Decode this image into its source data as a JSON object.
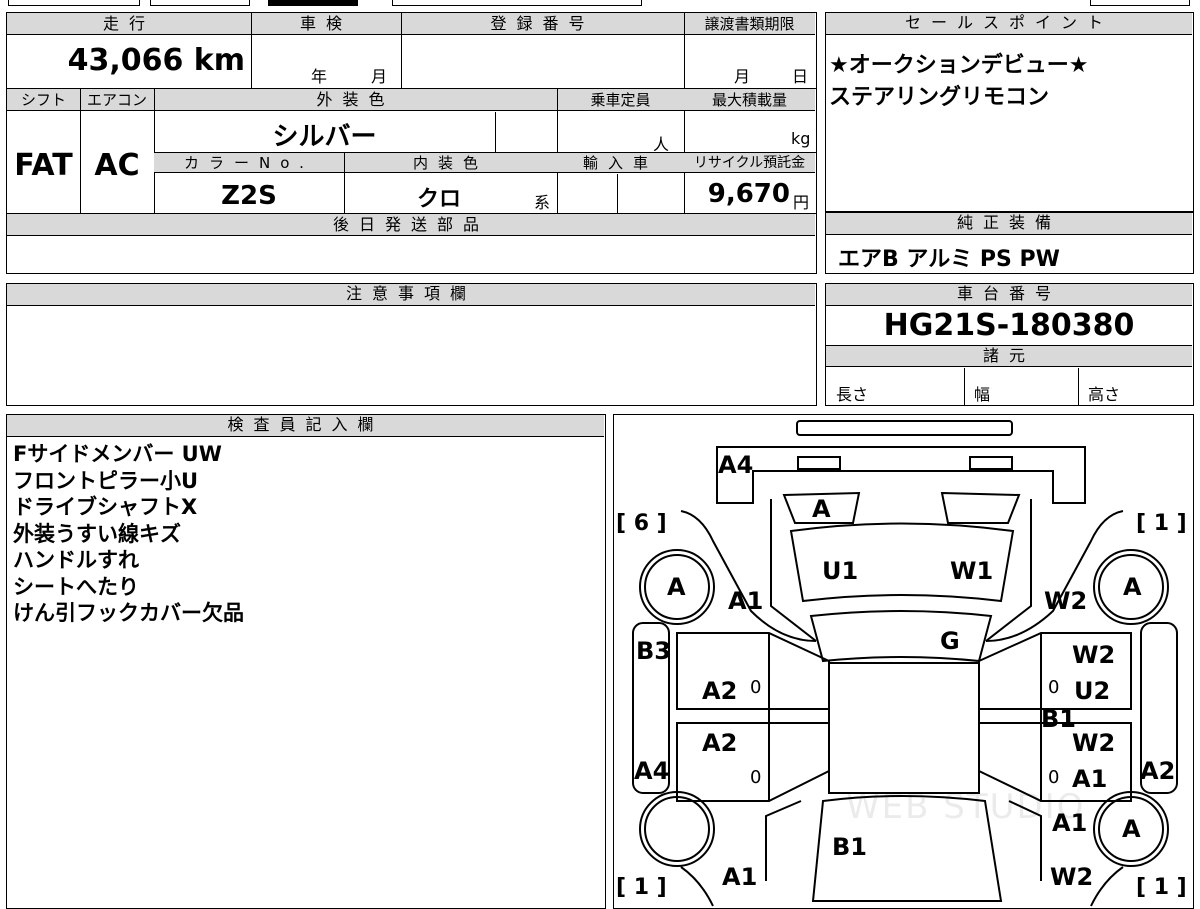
{
  "header": {
    "mileage_label": "走行",
    "inspection_label": "車検",
    "registration_label": "登録番号",
    "transfer_deadline_label": "譲渡書類期限",
    "mileage_value": "43,066 km",
    "year_unit": "年",
    "month_unit": "月",
    "deadline_month": "月",
    "deadline_day": "日",
    "shift_label": "シフト",
    "ac_label": "エアコン",
    "exterior_color_label": "外装色",
    "capacity_label": "乗車定員",
    "max_load_label": "最大積載量",
    "shift_value": "FAT",
    "ac_value": "AC",
    "exterior_color_value": "シルバー",
    "capacity_unit": "人",
    "load_unit": "kg",
    "color_no_label": "カラーNo.",
    "interior_color_label": "内装色",
    "import_label": "輸入車",
    "recycle_label": "リサイクル預託金",
    "color_no_value": "Z2S",
    "interior_color_value": "クロ",
    "interior_suffix": "系",
    "recycle_value": "9,670",
    "yen_unit": "円",
    "later_parts_label": "後日発送部品"
  },
  "sales_points": {
    "label": "セールスポイント",
    "line1": "★オークションデビュー★",
    "line2": "ステアリングリモコン"
  },
  "genuine_equipment": {
    "label": "純正装備",
    "value": "エアB アルミ PS PW"
  },
  "notes": {
    "label": "注意事項欄"
  },
  "chassis": {
    "label": "車台番号",
    "value": "HG21S-180380",
    "specs_label": "諸元",
    "length_label": "長さ",
    "width_label": "幅",
    "height_label": "高さ"
  },
  "inspector": {
    "label": "検査員記入欄",
    "lines": [
      "Fサイドメンバー UW",
      "フロントピラー小U",
      "ドライブシャフトX",
      "外装うすい線キズ",
      "ハンドルすれ",
      "シートへたり",
      "けん引フックカバー欠品"
    ]
  },
  "diagram": {
    "marks": {
      "A4_front": "A4",
      "A_front_center": "A",
      "bracket_left_top": "[ 6 ]",
      "bracket_right_top": "[ 1 ]",
      "U1": "U1",
      "W1": "W1",
      "A_wheel_fl": "A",
      "A1_left_front": "A1",
      "W2_right_front": "W2",
      "A_wheel_fr": "A",
      "G": "G",
      "B3": "B3",
      "W2_right_door": "W2",
      "A2_left_door": "A2",
      "zero_left_1": "0",
      "zero_right_1": "0",
      "U2": "U2",
      "B1_right": "B1",
      "A2_left_rear_door": "A2",
      "W2_right_rear_door": "W2",
      "A4_left": "A4",
      "zero_left_2": "0",
      "zero_right_2": "0",
      "A1_right_rear_door": "A1",
      "A2_right_side": "A2",
      "A1_right_rear": "A1",
      "A_wheel_rr": "A",
      "B1_roof": "B1",
      "A1_left_rear": "A1",
      "W2_right_rear": "W2",
      "bracket_left_bottom": "[ 1 ]",
      "bracket_right_bottom": "[ 1 ]",
      "watermark": "WEB STUDIO"
    }
  }
}
